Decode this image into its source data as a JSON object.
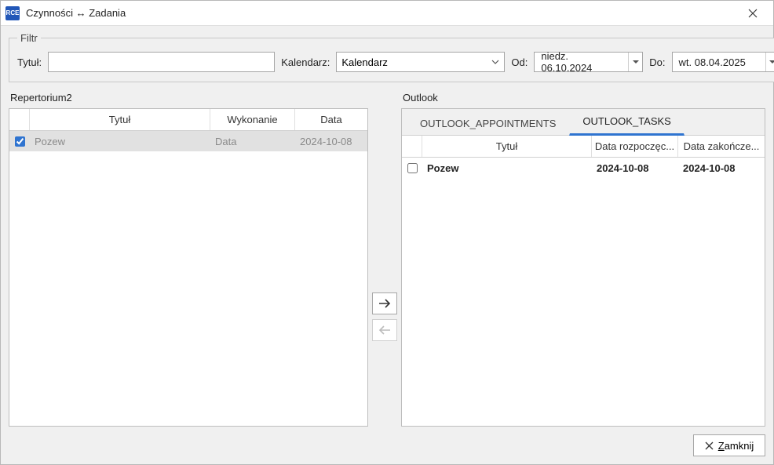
{
  "window": {
    "app_icon_text": "RCE",
    "title": "Czynności ↔ Zadania"
  },
  "filter": {
    "legend": "Filtr",
    "title_label": "Tytuł:",
    "title_value": "",
    "calendar_label": "Kalendarz:",
    "calendar_value": "Kalendarz",
    "from_label": "Od:",
    "from_value": "niedz. 06.10.2024",
    "to_label": "Do:",
    "to_value": "wt. 08.04.2025"
  },
  "left": {
    "heading": "Repertorium2",
    "columns": {
      "title": "Tytuł",
      "exec": "Wykonanie",
      "date": "Data"
    },
    "rows": [
      {
        "checked": true,
        "title": "Pozew",
        "exec": "Data",
        "date": "2024-10-08"
      }
    ]
  },
  "right": {
    "heading": "Outlook",
    "tabs": {
      "appointments": "OUTLOOK_APPOINTMENTS",
      "tasks": "OUTLOOK_TASKS",
      "active": "tasks"
    },
    "columns": {
      "title": "Tytuł",
      "start": "Data rozpoczęc...",
      "end": "Data zakończe..."
    },
    "rows": [
      {
        "checked": false,
        "title": "Pozew",
        "start": "2024-10-08",
        "end": "2024-10-08"
      }
    ]
  },
  "footer": {
    "close_prefix": "Z",
    "close_rest": "amknij"
  }
}
